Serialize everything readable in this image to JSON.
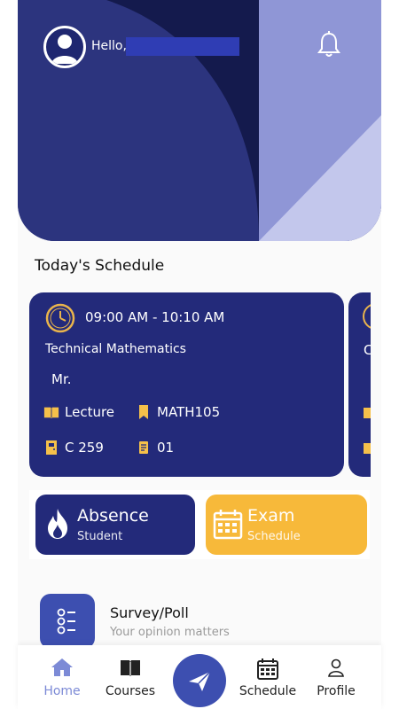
{
  "header": {
    "greeting": "Hello,",
    "colors": {
      "dark": "#141a4d",
      "primary": "#2c347e",
      "light": "#8f96d6",
      "lighter": "#c3c7ec"
    }
  },
  "schedule": {
    "section_title": "Today's Schedule",
    "cards": [
      {
        "time_start": "09:00 AM",
        "time_end": "- 10:10 AM",
        "course": "Technical Mathematics",
        "teacher": "Mr.",
        "type": "Lecture",
        "code": "MATH105",
        "room": "C 259",
        "group": "01"
      }
    ],
    "next_card_initial": "C"
  },
  "tiles": {
    "absence": {
      "title": "Absence",
      "subtitle": "Student",
      "color": "#232a7a"
    },
    "exam": {
      "title": "Exam",
      "subtitle": "Schedule",
      "color": "#f7b93a"
    }
  },
  "survey": {
    "title": "Survey/Poll",
    "subtitle": "Your opinion matters"
  },
  "nav": {
    "items": [
      {
        "label": "Home",
        "icon": "home-icon",
        "active": true
      },
      {
        "label": "Courses",
        "icon": "book-icon",
        "active": false
      },
      {
        "label": "Schedule",
        "icon": "calendar-icon",
        "active": false
      },
      {
        "label": "Profile",
        "icon": "user-icon",
        "active": false
      }
    ],
    "fab_icon": "send-icon"
  }
}
